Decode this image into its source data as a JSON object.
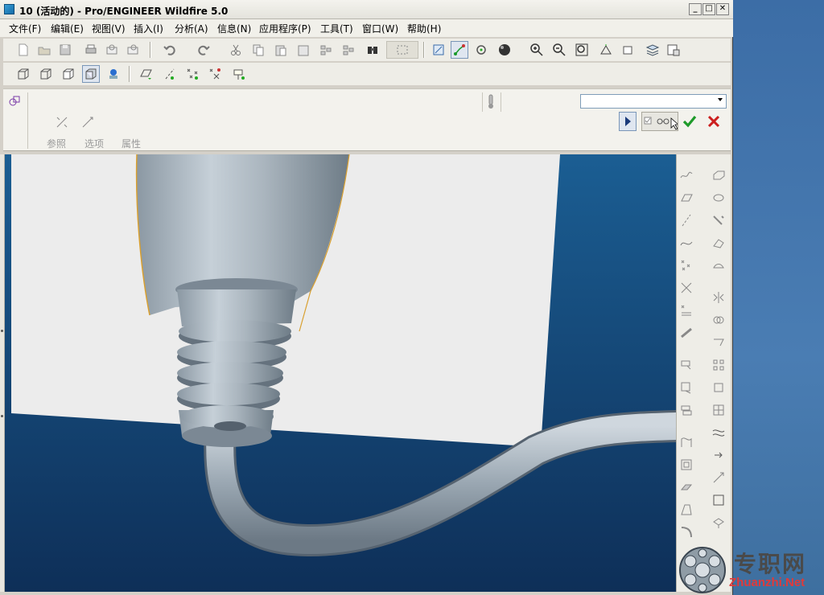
{
  "window": {
    "title": "10 (活动的) - Pro/ENGINEER Wildfire 5.0"
  },
  "menu": {
    "items": [
      {
        "name": "menu-file",
        "label": "文件(F)"
      },
      {
        "name": "menu-edit",
        "label": "编辑(E)"
      },
      {
        "name": "menu-view",
        "label": "视图(V)"
      },
      {
        "name": "menu-insert",
        "label": "插入(I)"
      },
      {
        "name": "menu-analysis",
        "label": "分析(A)"
      },
      {
        "name": "menu-info",
        "label": "信息(N)"
      },
      {
        "name": "menu-applications",
        "label": "应用程序(P)"
      },
      {
        "name": "menu-tools",
        "label": "工具(T)"
      },
      {
        "name": "menu-window",
        "label": "窗口(W)"
      },
      {
        "name": "menu-help",
        "label": "帮助(H)"
      }
    ]
  },
  "dashboard": {
    "tabs": [
      "参照",
      "选项",
      "属性"
    ],
    "combo_value": ""
  },
  "watermark": {
    "cn": "专职网",
    "en": "Zhuanzhi.Net"
  },
  "colors": {
    "accent_ok": "#1e9a2a",
    "accent_cancel": "#cc1f1f",
    "viewport_bg": "#154777"
  }
}
